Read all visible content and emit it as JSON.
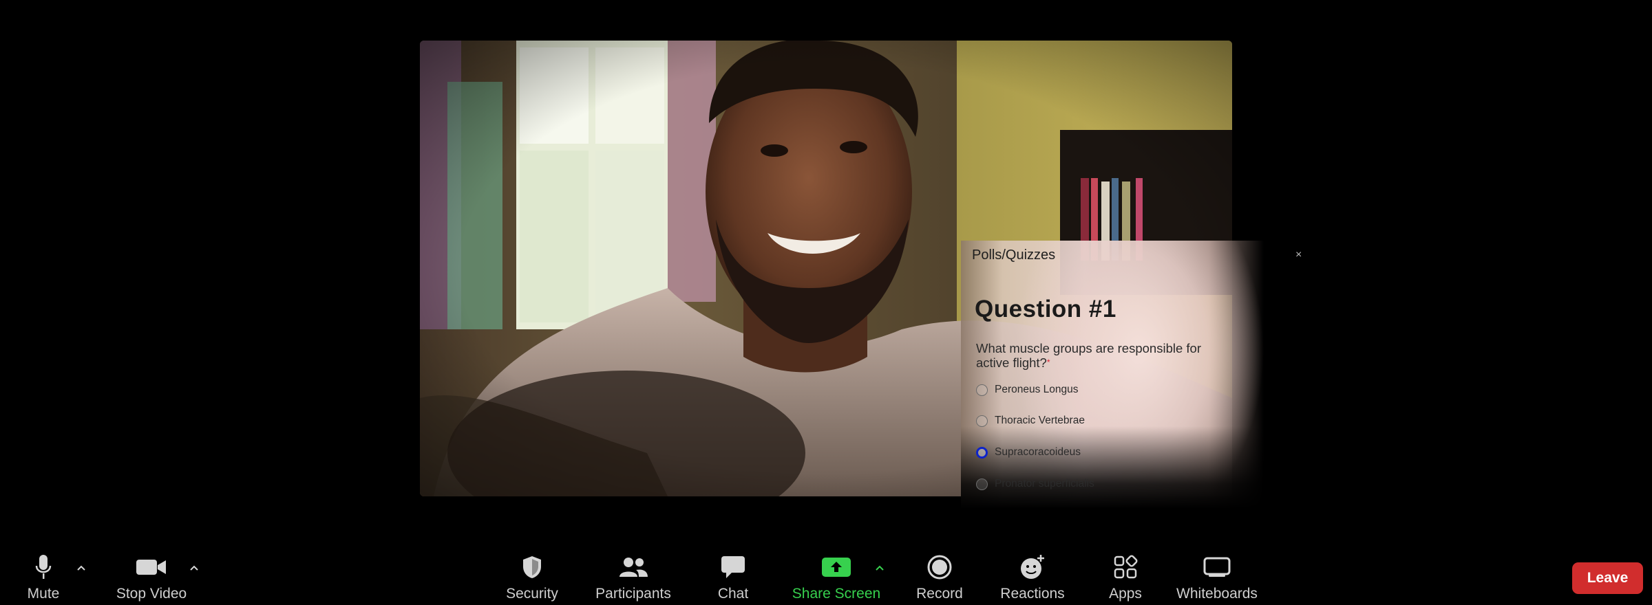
{
  "poll": {
    "title": "Polls/Quizzes",
    "close_symbol": "×",
    "question_heading": "Question #1",
    "question_text": "What muscle groups are responsible for active flight?",
    "required_marker": "*",
    "options": [
      {
        "label": "Peroneus Longus",
        "selected": false
      },
      {
        "label": "Thoracic Vertebrae",
        "selected": false
      },
      {
        "label": "Supracoracoideus",
        "selected": true
      },
      {
        "label": "Pronator superficialis",
        "selected": false
      }
    ]
  },
  "toolbar": {
    "mute": "Mute",
    "stop_video": "Stop Video",
    "security": "Security",
    "participants": "Participants",
    "chat": "Chat",
    "share_screen": "Share Screen",
    "record": "Record",
    "reactions": "Reactions",
    "apps": "Apps",
    "whiteboards": "Whiteboards",
    "leave": "Leave"
  },
  "colors": {
    "share_green": "#37d14e",
    "leave_red": "#d12d2d",
    "selected_radio": "#0d23c9",
    "toolbar_icon": "#d6d6d6"
  },
  "icons": [
    "microphone-icon",
    "video-camera-icon",
    "shield-icon",
    "people-icon",
    "chat-bubble-icon",
    "share-arrow-icon",
    "record-icon",
    "smiley-plus-icon",
    "apps-icon",
    "whiteboard-icon",
    "caret-up-icon",
    "close-icon"
  ]
}
